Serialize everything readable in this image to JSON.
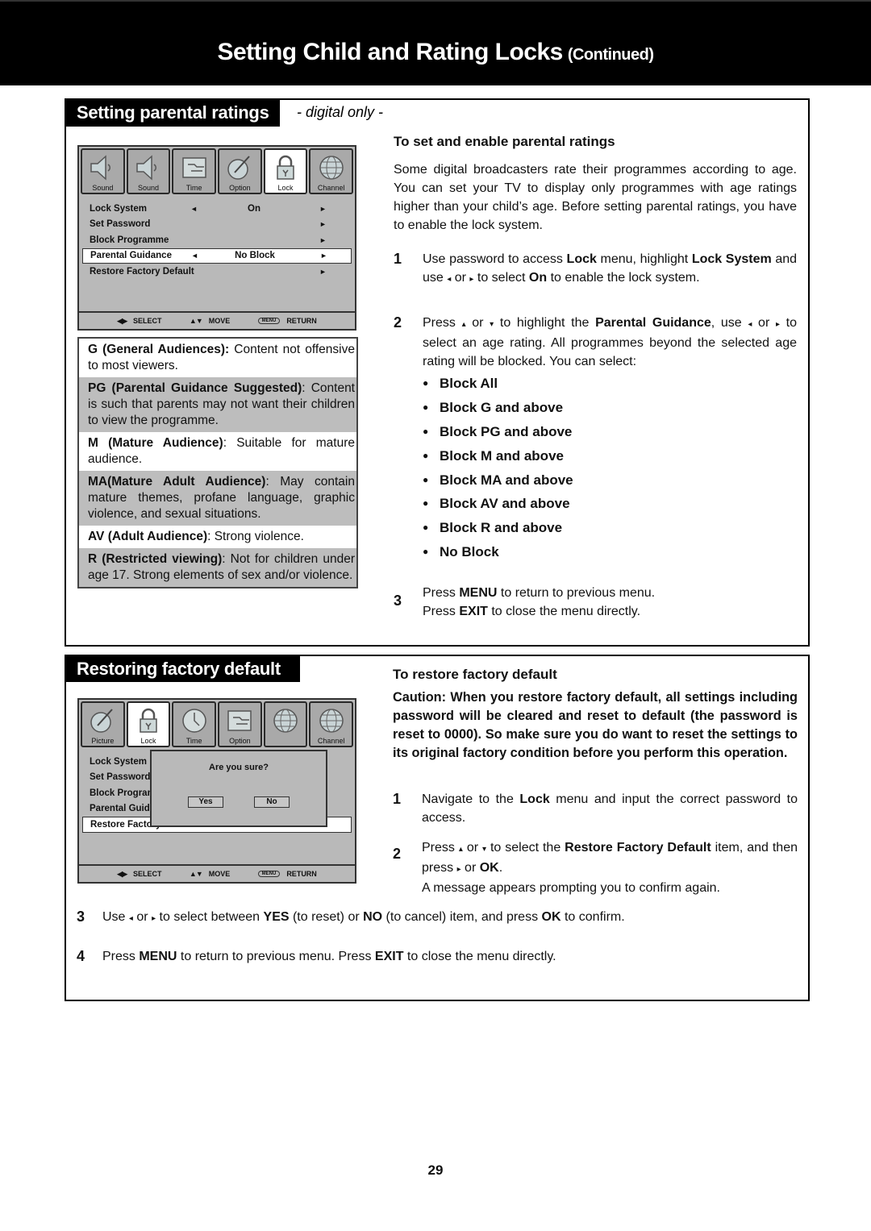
{
  "header": {
    "title": "Setting Child and Rating Locks",
    "suffix": "(Continued)"
  },
  "section1": {
    "title": "Setting parental ratings",
    "subtitle": "- digital only -",
    "tv_menu": {
      "tabs": [
        {
          "label": "Sound",
          "icon": "speaker-icon",
          "active": false
        },
        {
          "label": "Sound",
          "icon": "speaker-icon",
          "active": false
        },
        {
          "label": "Time",
          "icon": "option-icon",
          "active": false
        },
        {
          "label": "Option",
          "icon": "picture-icon",
          "active": false
        },
        {
          "label": "Lock",
          "icon": "lock-icon",
          "active": true
        },
        {
          "label": "Channel",
          "icon": "globe-icon",
          "active": false
        }
      ],
      "rows": [
        {
          "label": "Lock System",
          "left_arrow": "◄",
          "value": "On",
          "right_arrow": "►",
          "selected": false
        },
        {
          "label": "Set Password",
          "left_arrow": "",
          "value": "",
          "right_arrow": "►",
          "selected": false
        },
        {
          "label": "Block Programme",
          "left_arrow": "",
          "value": "",
          "right_arrow": "►",
          "selected": false
        },
        {
          "label": "Parental Guidance",
          "left_arrow": "◄",
          "value": "No Block",
          "right_arrow": "►",
          "selected": true
        },
        {
          "label": "Restore Factory Default",
          "left_arrow": "",
          "value": "",
          "right_arrow": "►",
          "selected": false
        }
      ],
      "footer": [
        {
          "key": "◀▶",
          "label": "SELECT"
        },
        {
          "key": "▲▼",
          "label": "MOVE"
        },
        {
          "key": "MENU",
          "label": "RETURN"
        }
      ]
    },
    "ratings": [
      {
        "bold": "G (General Audiences):",
        "text": " Content not offensive to most viewers.",
        "shaded": false
      },
      {
        "bold": "PG (Parental Guidance Suggested)",
        "text": ": Content is such that parents may not want their children to view the programme.",
        "shaded": true
      },
      {
        "bold": "M (Mature Audience)",
        "text": ": Suitable for mature audience.",
        "shaded": false
      },
      {
        "bold": "MA(Mature Adult Audience)",
        "text": ": May contain mature themes, profane language, graphic violence, and sexual situations.",
        "shaded": true
      },
      {
        "bold": "AV (Adult Audience)",
        "text": ": Strong violence.",
        "shaded": false
      },
      {
        "bold": "R (Restricted viewing)",
        "text": ": Not for children under age 17. Strong elements of sex and/or violence.",
        "shaded": true
      }
    ],
    "heading": "To set and enable parental ratings",
    "intro": "Some digital broadcasters rate their programmes according to age. You can set your TV to display only programmes with age ratings higher than your child’s age. Before setting parental ratings, you have to enable the lock system.",
    "step1": {
      "num": "1",
      "t1": "Use password to access ",
      "b1": "Lock",
      "t2": " menu, highlight ",
      "b2": "Lock System",
      "t3": " and use ",
      "t4": " or ",
      "t5": " to select ",
      "b3": "On",
      "t6": " to enable the lock system."
    },
    "step2": {
      "num": "2",
      "t1": "Press ",
      "t2": " or ",
      "t3": "  to highlight the ",
      "b1": "Parental Guidance",
      "t4": ", use ",
      "t5": " or ",
      "t6": " to select an age rating. All programmes beyond the selected age rating will be blocked. You can select:"
    },
    "options": [
      "Block All",
      "Block G and above",
      "Block PG and above",
      "Block M and above",
      "Block MA and above",
      "Block AV and above",
      "Block R and above",
      "No Block"
    ],
    "step3": {
      "num": "3",
      "t1": "Press ",
      "b1": "MENU",
      "t2": " to return to previous menu.",
      "t3": "Press ",
      "b2": "EXIT",
      "t4": " to close the menu directly."
    }
  },
  "section2": {
    "title": "Restoring factory default",
    "tv_menu": {
      "tabs": [
        {
          "label": "Picture",
          "icon": "picture-icon",
          "active": false
        },
        {
          "label": "Lock",
          "icon": "lock-icon",
          "active": true
        },
        {
          "label": "Time",
          "icon": "clock-icon",
          "active": false
        },
        {
          "label": "Option",
          "icon": "option-icon",
          "active": false
        },
        {
          "label": "",
          "icon": "globe-icon",
          "active": false
        },
        {
          "label": "Channel",
          "icon": "globe-icon",
          "active": false
        }
      ],
      "rows": [
        {
          "label": "Lock System",
          "selected": false
        },
        {
          "label": "Set Password",
          "selected": false
        },
        {
          "label": "Block Programme",
          "selected": false
        },
        {
          "label": "Parental Guidance",
          "selected": false
        },
        {
          "label": "Restore Factory Default",
          "selected": true
        }
      ],
      "dialog": {
        "question": "Are you sure?",
        "yes": "Yes",
        "no": "No"
      },
      "footer": [
        {
          "key": "◀▶",
          "label": "SELECT"
        },
        {
          "key": "▲▼",
          "label": "MOVE"
        },
        {
          "key": "MENU",
          "label": "RETURN"
        }
      ]
    },
    "heading": "To restore factory default",
    "caution": "Caution: When you restore factory default, all settings including password will be cleared and reset to default (the password is reset to 0000). So make sure you do want to reset the settings to its original factory condition before you perform this operation.",
    "step1": {
      "num": "1",
      "t1": "Navigate to the ",
      "b1": "Lock",
      "t2": " menu and input the correct password to access."
    },
    "step2": {
      "num": "2",
      "t1": "Press ",
      "t2": " or ",
      "t3": " to select the ",
      "b1": "Restore Factory Default",
      "t4": " item, and then press ",
      "t5": " or ",
      "b2": "OK",
      "t6": ".",
      "t7": "A message appears prompting you to confirm again."
    },
    "step3": {
      "num": "3",
      "t1": "Use ",
      "t2": " or ",
      "t3": " to select between ",
      "b1": "YES",
      "t4": " (to reset) or ",
      "b2": "NO",
      "t5": " (to cancel) item, and press ",
      "b3": "OK",
      "t6": " to confirm."
    },
    "step4": {
      "num": "4",
      "t1": "Press ",
      "b1": "MENU",
      "t2": " to return to previous menu. Press ",
      "b2": "EXIT",
      "t3": " to close the menu directly."
    }
  },
  "glyphs": {
    "left": "◂",
    "right": "▸",
    "up": "▴",
    "down": "▾"
  },
  "page_number": "29"
}
